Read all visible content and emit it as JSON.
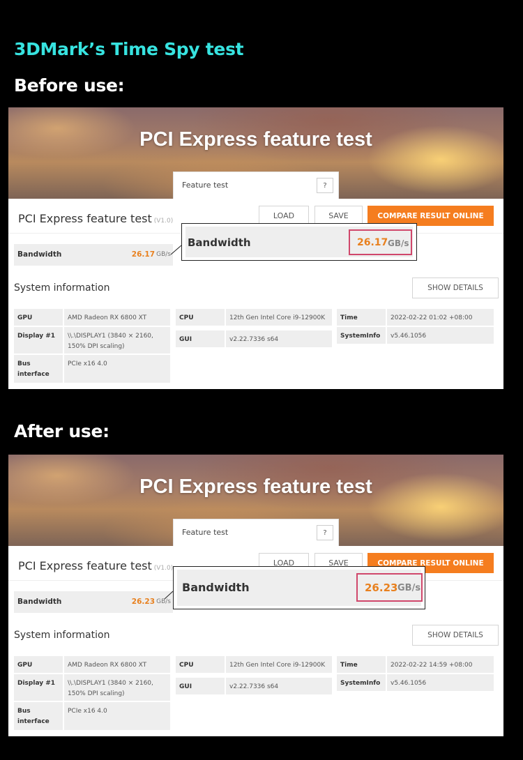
{
  "header": {
    "title": "3DMark’s Time Spy test",
    "before_label": "Before use:",
    "after_label": "After use:"
  },
  "colors": {
    "title_cyan": "#37e3e0",
    "accent_orange": "#f57d1f",
    "highlight_pink": "#d0476b"
  },
  "before": {
    "banner_title": "PCI Express feature test",
    "feature_label": "Feature test",
    "help_label": "?",
    "result_title": "PCI Express feature test",
    "version": "(V1.0)",
    "load_label": "LOAD",
    "save_label": "SAVE",
    "compare_label": "COMPARE RESULT ONLINE",
    "bandwidth_label": "Bandwidth",
    "bandwidth_value": "26.17",
    "bandwidth_unit": "GB/s",
    "system_info_title": "System information",
    "show_details_label": "SHOW DETAILS",
    "sys": {
      "gpu_label": "GPU",
      "gpu_value": "AMD Radeon RX 6800 XT",
      "display_label": "Display #1",
      "display_value": "\\\\.\\DISPLAY1 (3840 × 2160, 150% DPI scaling)",
      "bus_label": "Bus interface",
      "bus_value": "PCIe x16 4.0",
      "cpu_label": "CPU",
      "cpu_value": "12th Gen Intel Core i9-12900K",
      "gui_label": "GUI",
      "gui_value": "v2.22.7336 s64",
      "time_label": "Time",
      "time_value": "2022-02-22 01:02 +08:00",
      "sysinfo_label": "SystemInfo",
      "sysinfo_value": "v5.46.1056"
    }
  },
  "after": {
    "banner_title": "PCI Express feature test",
    "feature_label": "Feature test",
    "help_label": "?",
    "result_title": "PCI Express feature test",
    "version": "(V1.0)",
    "load_label": "LOAD",
    "save_label": "SAVE",
    "compare_label": "COMPARE RESULT ONLINE",
    "bandwidth_label": "Bandwidth",
    "bandwidth_value": "26.23",
    "bandwidth_unit": "GB/s",
    "system_info_title": "System information",
    "show_details_label": "SHOW DETAILS",
    "sys": {
      "gpu_label": "GPU",
      "gpu_value": "AMD Radeon RX 6800 XT",
      "display_label": "Display #1",
      "display_value": "\\\\.\\DISPLAY1 (3840 × 2160, 150% DPI scaling)",
      "bus_label": "Bus interface",
      "bus_value": "PCIe x16 4.0",
      "cpu_label": "CPU",
      "cpu_value": "12th Gen Intel Core i9-12900K",
      "gui_label": "GUI",
      "gui_value": "v2.22.7336 s64",
      "time_label": "Time",
      "time_value": "2022-02-22 14:59 +08:00",
      "sysinfo_label": "SystemInfo",
      "sysinfo_value": "v5.46.1056"
    }
  }
}
